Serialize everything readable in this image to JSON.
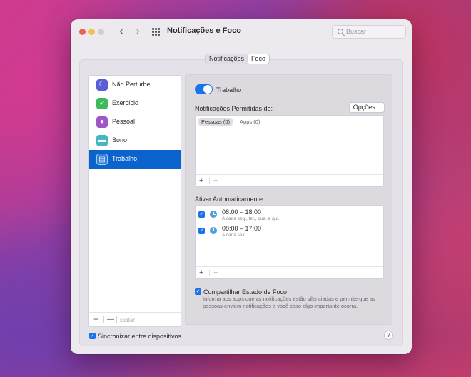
{
  "window": {
    "title": "Notificações e Foco",
    "search_placeholder": "Buscar"
  },
  "tabs": [
    {
      "label": "Notificações",
      "active": false
    },
    {
      "label": "Foco",
      "active": true
    }
  ],
  "sidebar": {
    "items": [
      {
        "label": "Não Perturbe",
        "icon": "moon-icon",
        "color": "#5b5fd6"
      },
      {
        "label": "Exercício",
        "icon": "runner-icon",
        "color": "#3dbb5b"
      },
      {
        "label": "Pessoal",
        "icon": "person-icon",
        "color": "#a056c9"
      },
      {
        "label": "Sono",
        "icon": "bed-icon",
        "color": "#44b6c4"
      },
      {
        "label": "Trabalho",
        "icon": "badge-icon",
        "color": "#2e7fd9",
        "selected": true
      }
    ],
    "add_label": "+",
    "remove_label": "—",
    "edit_label": "Editar"
  },
  "focus": {
    "toggle_label": "Trabalho",
    "toggle_on": true,
    "allowed_label": "Notificações Permitidas de:",
    "options_button": "Opções...",
    "subtabs": [
      {
        "label": "Pessoas (0)",
        "active": true
      },
      {
        "label": "Apps (0)",
        "active": false
      }
    ],
    "auto_label": "Ativar Automaticamente",
    "schedules": [
      {
        "time": "08:00 – 18:00",
        "days": "A cada seg., ter., qua. e qui.",
        "checked": true
      },
      {
        "time": "08:00 – 17:00",
        "days": "A cada sex.",
        "checked": true
      }
    ],
    "share_label": "Compartilhar Estado de Foco",
    "share_checked": true,
    "share_description": "Informa aos apps que as notificações estão silenciadas e permite que as pessoas enviem notificações a você caso algo importante ocorra."
  },
  "footer": {
    "sync_label": "Sincronizar entre dispositivos",
    "sync_checked": true,
    "help_label": "?"
  },
  "colors": {
    "accent": "#1a73e8",
    "selection": "#0b63ce"
  }
}
